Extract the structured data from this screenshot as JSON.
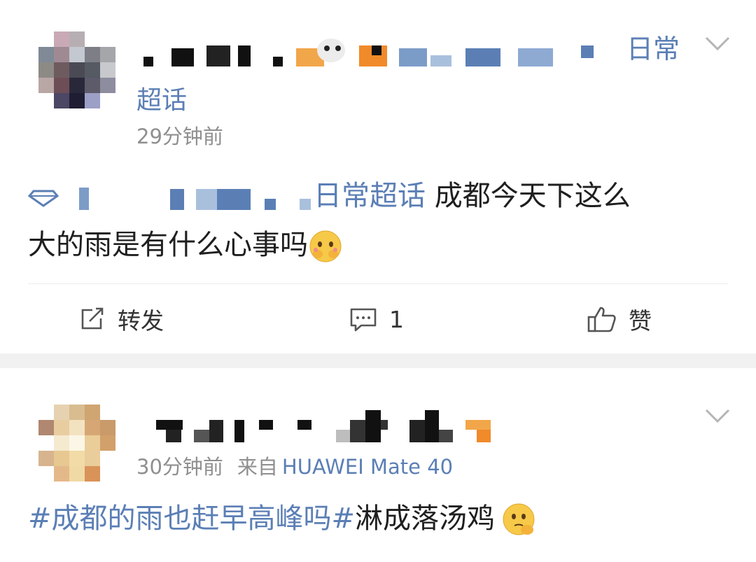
{
  "post1": {
    "name_suffix": "日常",
    "name_suffix_line2": "超话",
    "time": "29分钟前",
    "content_link": "日常超话",
    "content_text_1": "成都今天下这么",
    "content_text_2": "大的雨是有什么心事吗",
    "actions": {
      "repost_label": "转发",
      "comment_count": "1",
      "like_label": "赞"
    }
  },
  "post2": {
    "time": "30分钟前",
    "source_prefix": "来自",
    "device": "HUAWEI Mate 40",
    "hashtag": "#成都的雨也赶早高峰吗#",
    "content_text": "淋成落汤鸡"
  },
  "icons": {
    "chevron": "chevron-down-icon",
    "repost": "repost-icon",
    "comment": "comment-icon",
    "like": "thumbs-up-icon",
    "supertopic": "diamond-icon"
  },
  "colors": {
    "link": "#5b7fb5",
    "time": "#8f8f8f",
    "separator": "#f1f1f1"
  }
}
